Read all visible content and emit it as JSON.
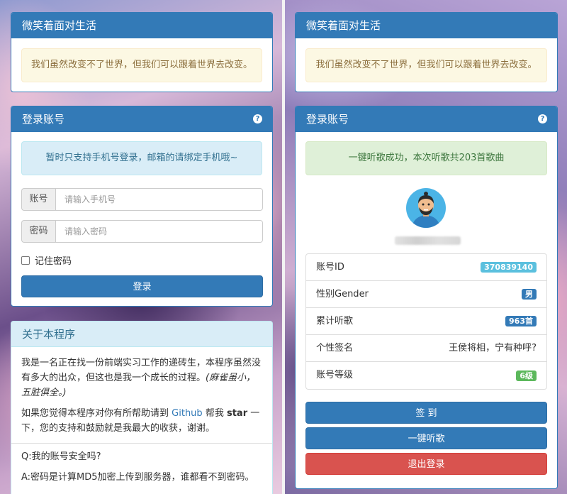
{
  "left": {
    "motto_panel": {
      "title": "微笑着面对生活",
      "message": "我们虽然改变不了世界，但我们可以跟着世界去改变。"
    },
    "login_panel": {
      "title": "登录账号",
      "help_icon": "question-circle-icon",
      "notice": "暂时只支持手机号登录，邮箱的请绑定手机哦~",
      "account_label": "账号",
      "account_placeholder": "请输入手机号",
      "password_label": "密码",
      "password_placeholder": "请输入密码",
      "remember_label": "记住密码",
      "login_button": "登录"
    },
    "about_panel": {
      "title": "关于本程序",
      "para1_text": "我是一名正在找一份前端实习工作的递砖生，本程序虽然没有多大的出众，但这也是我一个成长的过程。",
      "para1_em": "(麻雀虽小，五脏俱全。)",
      "para2_prefix": "如果您觉得本程序对你有所帮助请到",
      "para2_link": "Github",
      "para2_mid": "帮我",
      "para2_strong": "star",
      "para2_suffix": "一下，您的支持和鼓励就是我最大的收获，谢谢。",
      "faq_q": "Q:我的账号安全吗?",
      "faq_a": "A:密码是计算MD5加密上传到服务器，谁都看不到密码。"
    }
  },
  "right": {
    "motto_panel": {
      "title": "微笑着面对生活",
      "message": "我们虽然改变不了世界，但我们可以跟着世界去改变。"
    },
    "account_panel": {
      "title": "登录账号",
      "help_icon": "question-circle-icon",
      "success": "一键听歌成功，本次听歌共203首歌曲",
      "avatar": "user-avatar-icon",
      "info": [
        {
          "label": "账号ID",
          "value": "370839140",
          "badge_color": "#5bc0de"
        },
        {
          "label": "性别Gender",
          "value": "男",
          "badge_color": "#337ab7"
        },
        {
          "label": "累计听歌",
          "value": "963首",
          "badge_color": "#337ab7"
        },
        {
          "label": "个性签名",
          "value": "王侯将相，宁有种呼?",
          "badge_color": ""
        },
        {
          "label": "账号等级",
          "value": "6级",
          "badge_color": "#5cb85c"
        }
      ],
      "signin_button": "签 到",
      "listen_button": "一键听歌",
      "logout_button": "退出登录"
    }
  }
}
